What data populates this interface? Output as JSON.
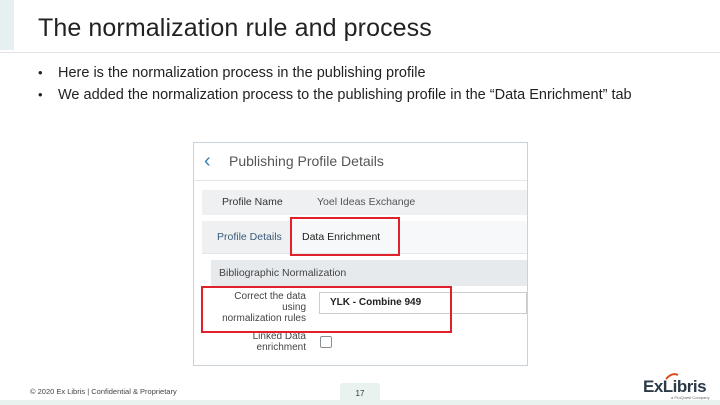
{
  "slide": {
    "title": "The normalization rule and process",
    "bullets": [
      "Here is the normalization process in the publishing profile",
      "We added the normalization process to the publishing profile in the “Data Enrichment” tab"
    ]
  },
  "screenshot": {
    "back_icon": "chevron-left-icon",
    "title": "Publishing Profile Details",
    "profile_name_label": "Profile Name",
    "profile_name_value": "Yoel Ideas Exchange",
    "tabs": [
      "Profile Details",
      "Data Enrichment"
    ],
    "section_title": "Bibliographic Normalization",
    "correct_label_lines": [
      "Correct the data",
      "using",
      "normalization rules"
    ],
    "rule_value": "YLK - Combine 949",
    "linked_label_lines": [
      "Linked Data",
      "enrichment"
    ],
    "highlight_color": "#e0202b"
  },
  "footer": {
    "copyright": "© 2020 Ex Libris | Confidential & Proprietary",
    "page_number": "17",
    "logo_text": "ExLibris",
    "logo_tagline": "a ProQuest Company"
  }
}
